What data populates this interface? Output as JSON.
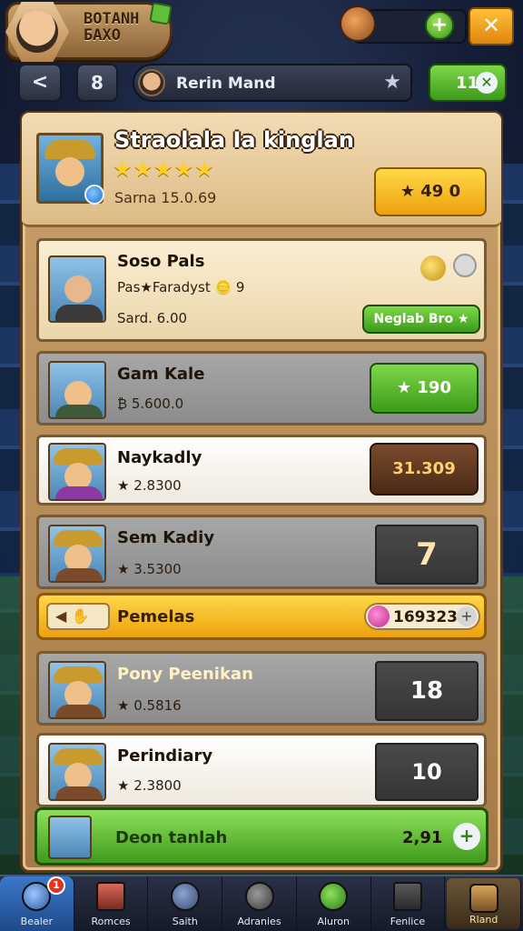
{
  "header": {
    "profile_name_line1": "ΒΟΤΑΝΗ",
    "profile_name_line2": "БAXO",
    "close_label": "✕",
    "plus_label": "+"
  },
  "nav": {
    "back_label": "<",
    "filter_label": "8",
    "search_text": "Rerin Mand",
    "count_label": "11"
  },
  "featured": {
    "title": "Straolala Ia kinglan",
    "stars": "★★★★★",
    "subtitle": "Sarna 15.0.69",
    "button_label": "★ 49 0"
  },
  "rows": [
    {
      "name": "Soso Pals",
      "detail": "Pas★Faradyst 🪙 9",
      "detail2": "Sard. 6.00",
      "action": "Neglab Bro ★",
      "style": "cream"
    },
    {
      "name": "Gam Kale",
      "detail": "₿ 5.600.0",
      "action": "★ 190",
      "style": "grey"
    },
    {
      "name": "Naykadly",
      "detail": "★ 2.8300",
      "action": "31.309",
      "style": "light"
    },
    {
      "name": "Sem Kadiy",
      "detail": "★ 3.5300",
      "action": "7",
      "style": "grey"
    },
    {
      "name": "Pony Peenikan",
      "detail": "★ 0.5816",
      "action": "18",
      "style": "grey"
    },
    {
      "name": "Perindiary",
      "detail": "★ 2.3800",
      "action": "10",
      "style": "light"
    }
  ],
  "gold_bar": {
    "left_label": "◀ ✋",
    "text": "Pemelas",
    "value": "169323"
  },
  "green_bar": {
    "text": "Deon tanlah",
    "value": "2,91",
    "plus": "+"
  },
  "bottom_nav": [
    {
      "label": "Bealer",
      "active": true,
      "badge": "1"
    },
    {
      "label": "Romces"
    },
    {
      "label": "Saith"
    },
    {
      "label": "Adranies"
    },
    {
      "label": "Aluron"
    },
    {
      "label": "Fenlice"
    },
    {
      "label": "Rland",
      "shop": true
    }
  ]
}
